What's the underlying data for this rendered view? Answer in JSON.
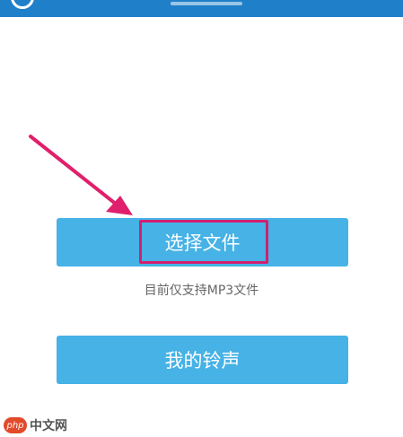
{
  "buttons": {
    "select_file": "选择文件",
    "my_ringtones": "我的铃声"
  },
  "hint": "目前仅支持MP3文件",
  "watermark": {
    "logo": "php",
    "site": "中文网"
  },
  "colors": {
    "header": "#1f7fc9",
    "button": "#46b2e6",
    "highlight": "#d2206e",
    "arrow": "#e0206c"
  }
}
